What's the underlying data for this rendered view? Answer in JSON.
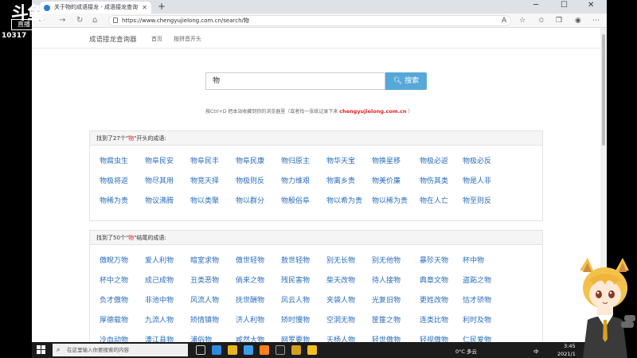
{
  "watermark": {
    "logo": "斗鱼",
    "sub": "直播",
    "room": "10317"
  },
  "browser": {
    "tab_title": "关于物的成语接龙 - 成语接龙查询",
    "url": "https://www.chengyujielong.com.cn/search/物"
  },
  "site": {
    "logo": "成语接龙查询器",
    "nav": [
      "首页",
      "按拼音开头"
    ],
    "search_value": "物",
    "search_button": "搜索",
    "hint_text": "按Ctrl+D 把本站收藏到你的浏览器里（或者找一张纸记录下来",
    "hint_domain": "chengyujielong.com.cn",
    "hint_end": "）"
  },
  "panel_start": {
    "prefix": "找到了27个\"",
    "keyword": "物",
    "suffix": "\"开头的成语:",
    "idioms": [
      "物腐虫生",
      "物阜民安",
      "物阜民丰",
      "物阜民康",
      "物归原主",
      "物华天宝",
      "物换星移",
      "物极必返",
      "物极必反",
      "物极将返",
      "物尽其用",
      "物竞天择",
      "物极则反",
      "物力维艰",
      "物离乡贵",
      "物美价廉",
      "物伤其类",
      "物是人非",
      "物稀为贵",
      "物议沸腾",
      "物以类聚",
      "物以群分",
      "物殷俗阜",
      "物以希为贵",
      "物以稀为贵",
      "物在人亡",
      "物至则反"
    ]
  },
  "panel_end": {
    "prefix": "找到了50个\"",
    "keyword": "物",
    "suffix": "\"结尾的成语:",
    "idioms": [
      "傲睨万物",
      "爱人利物",
      "暗室求物",
      "傲世轻物",
      "敖世轻物",
      "别无长物",
      "别无他物",
      "暴殄天物",
      "杯中物",
      "杯中之物",
      "成己成物",
      "丑类恶物",
      "倘来之物",
      "残民害物",
      "柴天改物",
      "待人接物",
      "典章文物",
      "盗跖之物",
      "负才傲物",
      "非池中物",
      "风流人物",
      "抚世酬物",
      "风云人物",
      "夹袋人物",
      "光复旧物",
      "更姓改物",
      "怙才骄物",
      "厚德载物",
      "九流人物",
      "矫情镇物",
      "济人利物",
      "矫时慢物",
      "空洞无物",
      "筐篚之物",
      "连类比物",
      "利时及物",
      "冷血动物",
      "澳江县物",
      "浦俗物",
      "咸然大物",
      "网罗要物",
      "天杨人物",
      "轻世傲物",
      "轻视傲物",
      "仁民爱物"
    ]
  },
  "taskbar": {
    "search_placeholder": "在这里输入你要搜索的内容",
    "weather": "0°C 多云",
    "ime": "中",
    "time": "3:45",
    "date": "2021/1"
  },
  "colors": {
    "link": "#2a6ebb",
    "accent": "#56a8d8",
    "keyword": "#e02020"
  }
}
